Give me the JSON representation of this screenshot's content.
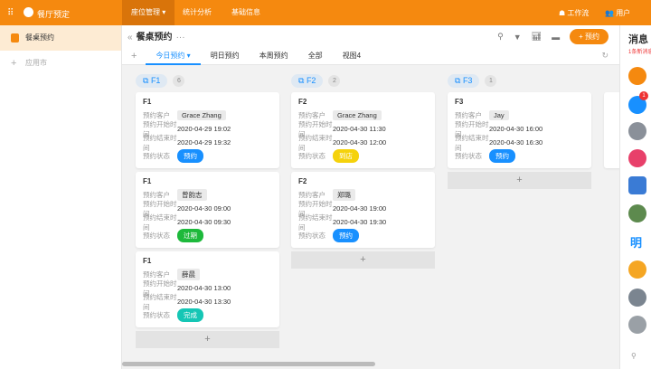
{
  "topbar": {
    "app_name": "餐厅预定",
    "nav": [
      "座位管理",
      "统计分析",
      "基础信息"
    ],
    "workbench": "工作流",
    "users": "用户"
  },
  "sidebar": {
    "items": [
      "餐桌预约"
    ],
    "add_app": "应用市"
  },
  "header": {
    "title": "餐桌预约",
    "reserve_button": "预约",
    "tabs": [
      "今日预约",
      "明日预约",
      "本周预约",
      "全部",
      "视图4"
    ]
  },
  "labels": {
    "customer": "预约客户",
    "start": "预约开始时间",
    "end": "预约结束时间",
    "status": "预约状态"
  },
  "columns": [
    {
      "name": "F1",
      "count": "6",
      "cards": [
        {
          "table": "F1",
          "customer": "Grace Zhang",
          "start": "2020-04-29 19:02",
          "end": "2020-04-29 19:32",
          "status": "预约",
          "color": "#1890ff"
        },
        {
          "table": "F1",
          "customer": "曾韵志",
          "start": "2020-04-30 09:00",
          "end": "2020-04-30 09:30",
          "status": "过期",
          "color": "#1db93b"
        },
        {
          "table": "F1",
          "customer": "薛晨",
          "start": "2020-04-30 13:00",
          "end": "2020-04-30 13:30",
          "status": "完成",
          "color": "#15c6b5"
        }
      ]
    },
    {
      "name": "F2",
      "count": "2",
      "cards": [
        {
          "table": "F2",
          "customer": "Grace Zhang",
          "start": "2020-04-30 11:30",
          "end": "2020-04-30 12:00",
          "status": "到店",
          "color": "#f5d20c"
        },
        {
          "table": "F2",
          "customer": "郑璐",
          "start": "2020-04-30 19:00",
          "end": "2020-04-30 19:30",
          "status": "预约",
          "color": "#1890ff"
        }
      ]
    },
    {
      "name": "F3",
      "count": "1",
      "cards": [
        {
          "table": "F3",
          "customer": "Jay",
          "start": "2020-04-30 16:00",
          "end": "2020-04-30 16:30",
          "status": "预约",
          "color": "#1890ff"
        }
      ]
    }
  ],
  "messages": {
    "title": "消息",
    "notice": "1条新消息",
    "badge": "1",
    "ming": "明"
  }
}
